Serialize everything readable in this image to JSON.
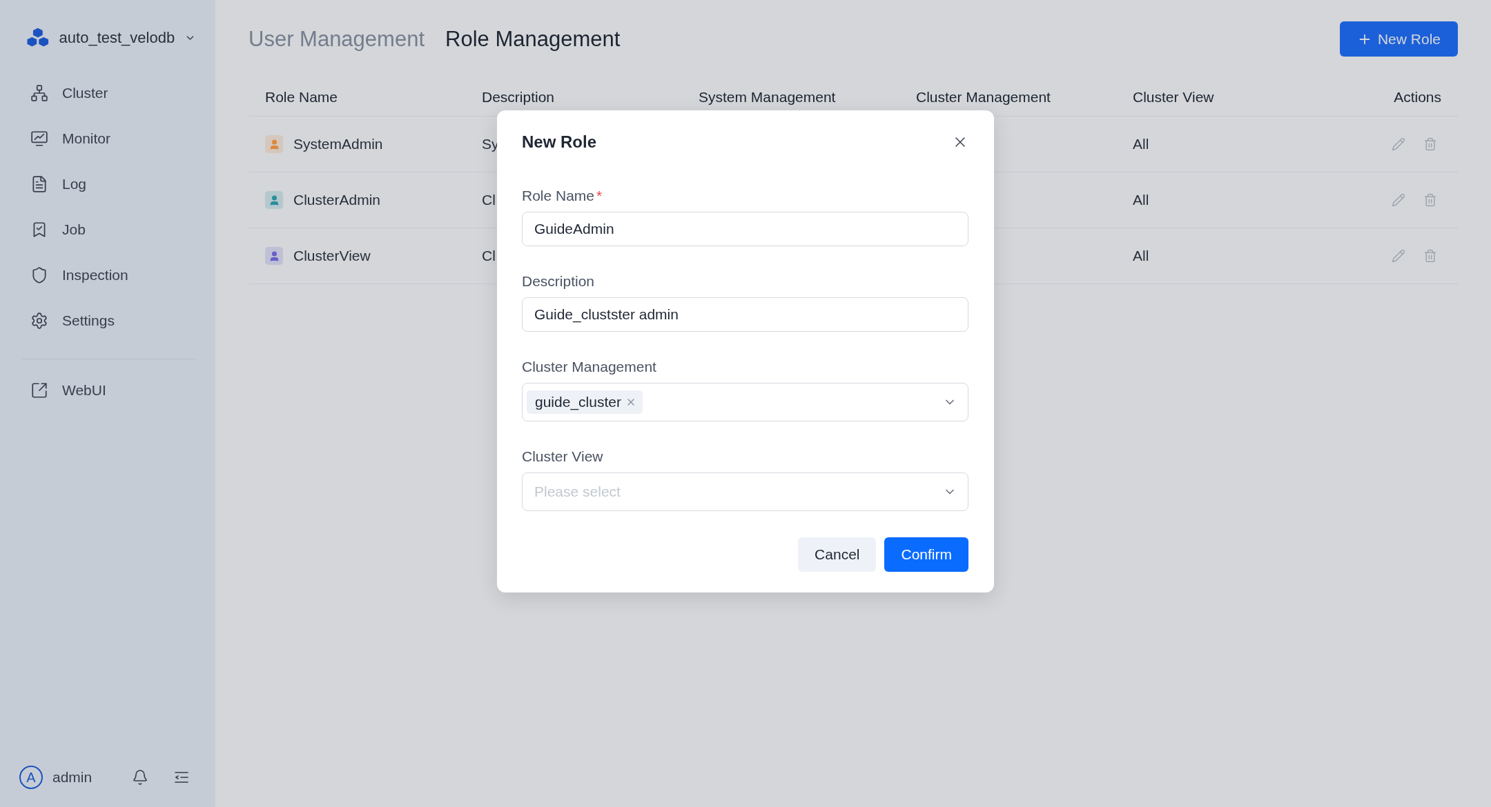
{
  "workspace": {
    "name": "auto_test_velodb"
  },
  "sidebar": {
    "items": [
      {
        "label": "Cluster"
      },
      {
        "label": "Monitor"
      },
      {
        "label": "Log"
      },
      {
        "label": "Job"
      },
      {
        "label": "Inspection"
      },
      {
        "label": "Settings"
      }
    ],
    "links": [
      {
        "label": "WebUI"
      }
    ]
  },
  "user": {
    "initial": "A",
    "name": "admin"
  },
  "tabs": [
    {
      "label": "User Management",
      "selected": false
    },
    {
      "label": "Role Management",
      "selected": true
    }
  ],
  "new_role_button": {
    "label": "New Role"
  },
  "table": {
    "columns": [
      "Role Name",
      "Description",
      "System Management",
      "Cluster Management",
      "Cluster View",
      "Actions"
    ],
    "rows": [
      {
        "name": "SystemAdmin",
        "color": "#d98a3e",
        "description": "Sy",
        "cluster_view": "All"
      },
      {
        "name": "ClusterAdmin",
        "color": "#2a8f9a",
        "description": "Cl",
        "cluster_view": "All"
      },
      {
        "name": "ClusterView",
        "color": "#6660c8",
        "description": "Cl",
        "cluster_view": "All"
      }
    ]
  },
  "dialog": {
    "title": "New Role",
    "fields": [
      {
        "kind": "text",
        "label": "Role Name",
        "required_mark": "*",
        "value": "GuideAdmin"
      },
      {
        "kind": "text",
        "label": "Description",
        "value": "Guide_clustster admin"
      },
      {
        "kind": "multiselect",
        "label": "Cluster Management",
        "tags": [
          "guide_cluster"
        ]
      },
      {
        "kind": "select",
        "label": "Cluster View",
        "placeholder": "Please select"
      }
    ],
    "buttons": [
      {
        "kind": "secondary",
        "label": "Cancel"
      },
      {
        "kind": "primary",
        "label": "Confirm"
      }
    ]
  }
}
